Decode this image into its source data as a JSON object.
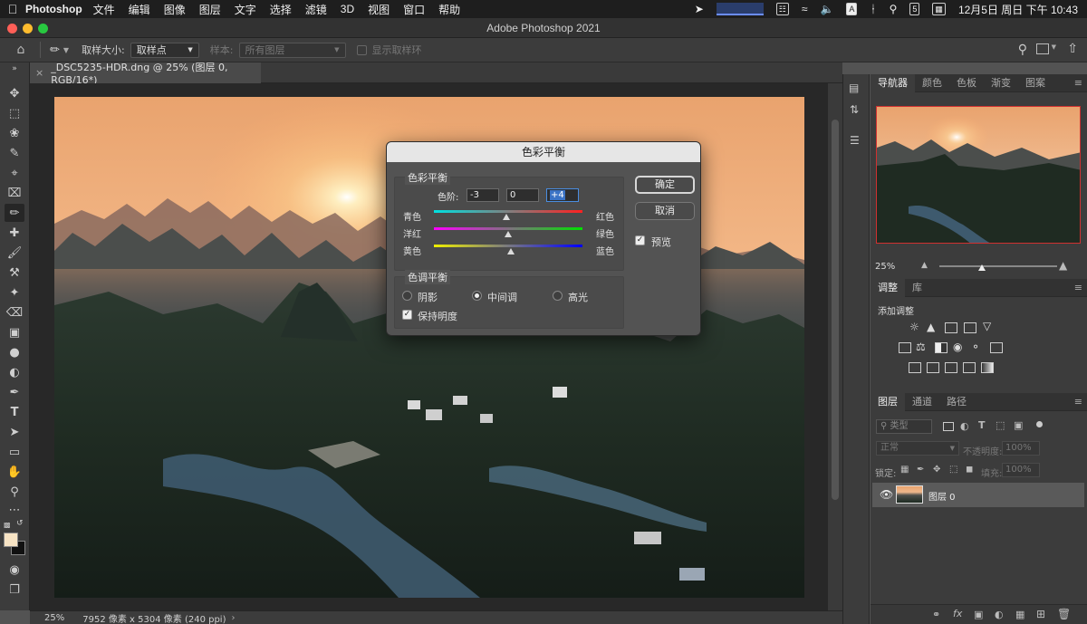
{
  "menubar": {
    "app": "Photoshop",
    "items": [
      "文件",
      "编辑",
      "图像",
      "图层",
      "文字",
      "选择",
      "滤镜",
      "3D",
      "视图",
      "窗口",
      "帮助"
    ],
    "input_badge": "A",
    "date_badge": "5",
    "clock": "12月5日 周日 下午 10:43"
  },
  "window": {
    "title": "Adobe Photoshop 2021"
  },
  "options_bar": {
    "sample_size_label": "取样大小:",
    "sample_size_value": "取样点",
    "sample_label": "样本:",
    "sample_value": "所有图层",
    "show_ring_label": "显示取样环"
  },
  "document": {
    "tab_title": "_DSC5235-HDR.dng @ 25% (图层 0, RGB/16*)",
    "zoom": "25%",
    "dimensions": "7952 像素 x 5304 像素 (240 ppi)"
  },
  "dialog": {
    "title": "色彩平衡",
    "balance_group": "色彩平衡",
    "levels_label": "色阶:",
    "levels": [
      "-3",
      "0",
      "+4"
    ],
    "sliders": [
      {
        "left": "青色",
        "right": "红色",
        "value": -3
      },
      {
        "left": "洋红",
        "right": "绿色",
        "value": 0
      },
      {
        "left": "黄色",
        "right": "蓝色",
        "value": 4
      }
    ],
    "tone_group": "色调平衡",
    "tones": [
      "阴影",
      "中间调",
      "高光"
    ],
    "selected_tone": "中间调",
    "preserve_luminosity": "保持明度",
    "ok": "确定",
    "cancel": "取消",
    "preview": "预览"
  },
  "navigator": {
    "tabs": [
      "导航器",
      "颜色",
      "色板",
      "渐变",
      "图案"
    ],
    "zoom": "25%"
  },
  "adjustments": {
    "tabs": [
      "调整",
      "库"
    ],
    "add_label": "添加调整"
  },
  "layers": {
    "tabs": [
      "图层",
      "通道",
      "路径"
    ],
    "filter_placeholder": "类型",
    "blend_mode": "正常",
    "opacity_label": "不透明度:",
    "opacity_value": "100%",
    "lock_label": "锁定:",
    "fill_label": "填充:",
    "fill_value": "100%",
    "layer_name": "图层 0"
  }
}
